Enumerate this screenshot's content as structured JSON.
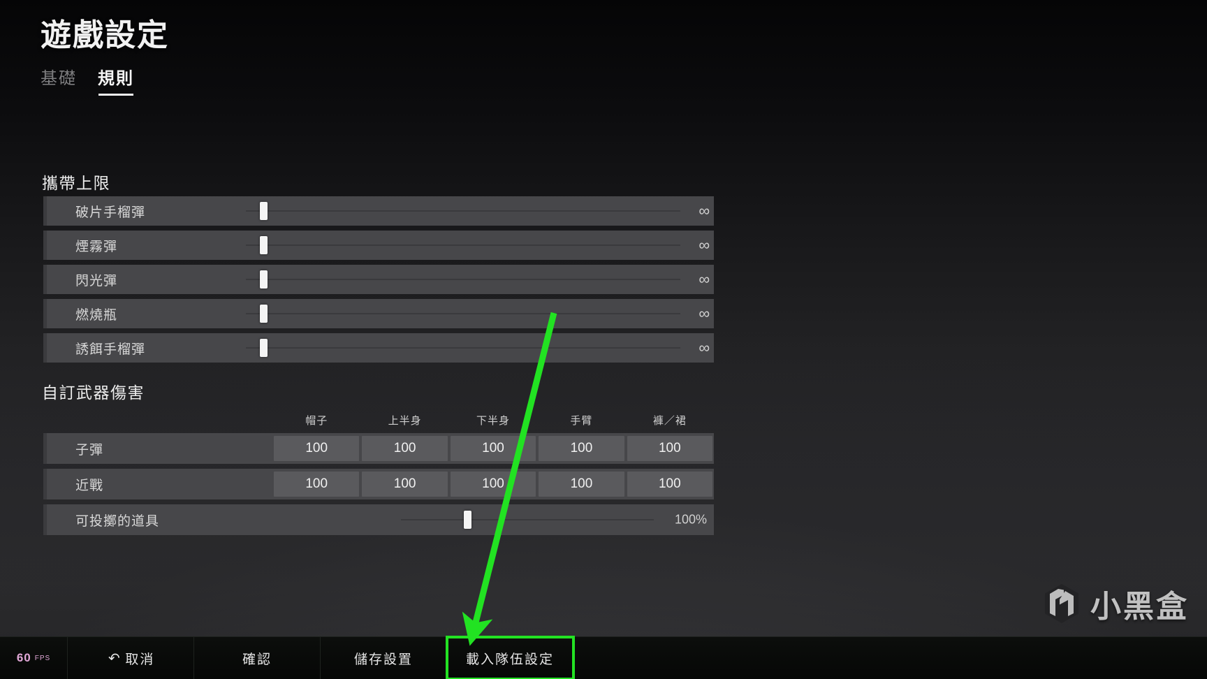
{
  "header": {
    "title": "遊戲設定",
    "tabs": [
      {
        "label": "基礎",
        "active": false
      },
      {
        "label": "規則",
        "active": true
      }
    ]
  },
  "sections": {
    "carry_limit": {
      "title": "攜帶上限",
      "rows": [
        {
          "label": "破片手榴彈",
          "value": "∞",
          "slider_percent": 3
        },
        {
          "label": "煙霧彈",
          "value": "∞",
          "slider_percent": 3
        },
        {
          "label": "閃光彈",
          "value": "∞",
          "slider_percent": 3
        },
        {
          "label": "燃燒瓶",
          "value": "∞",
          "slider_percent": 3
        },
        {
          "label": "誘餌手榴彈",
          "value": "∞",
          "slider_percent": 3
        }
      ]
    },
    "weapon_damage": {
      "title": "自訂武器傷害",
      "columns": [
        "帽子",
        "上半身",
        "下半身",
        "手臂",
        "褲／裙"
      ],
      "rows": [
        {
          "label": "子彈",
          "values": [
            "100",
            "100",
            "100",
            "100",
            "100"
          ]
        },
        {
          "label": "近戰",
          "values": [
            "100",
            "100",
            "100",
            "100",
            "100"
          ]
        }
      ],
      "throwable": {
        "label": "可投擲的道具",
        "value": "100%",
        "slider_percent": 28
      }
    }
  },
  "bottom_bar": {
    "fps": {
      "number": "60",
      "unit": "FPS"
    },
    "buttons": [
      {
        "label": "取消",
        "icon": "undo-icon",
        "highlighted": false
      },
      {
        "label": "確認",
        "icon": "",
        "highlighted": false
      },
      {
        "label": "儲存設置",
        "icon": "",
        "highlighted": false
      },
      {
        "label": "載入隊伍設定",
        "icon": "",
        "highlighted": true
      }
    ]
  },
  "annotation": {
    "arrow_color": "#22e222",
    "highlight_color": "#23e223"
  },
  "watermark": {
    "text": "小黑盒"
  }
}
